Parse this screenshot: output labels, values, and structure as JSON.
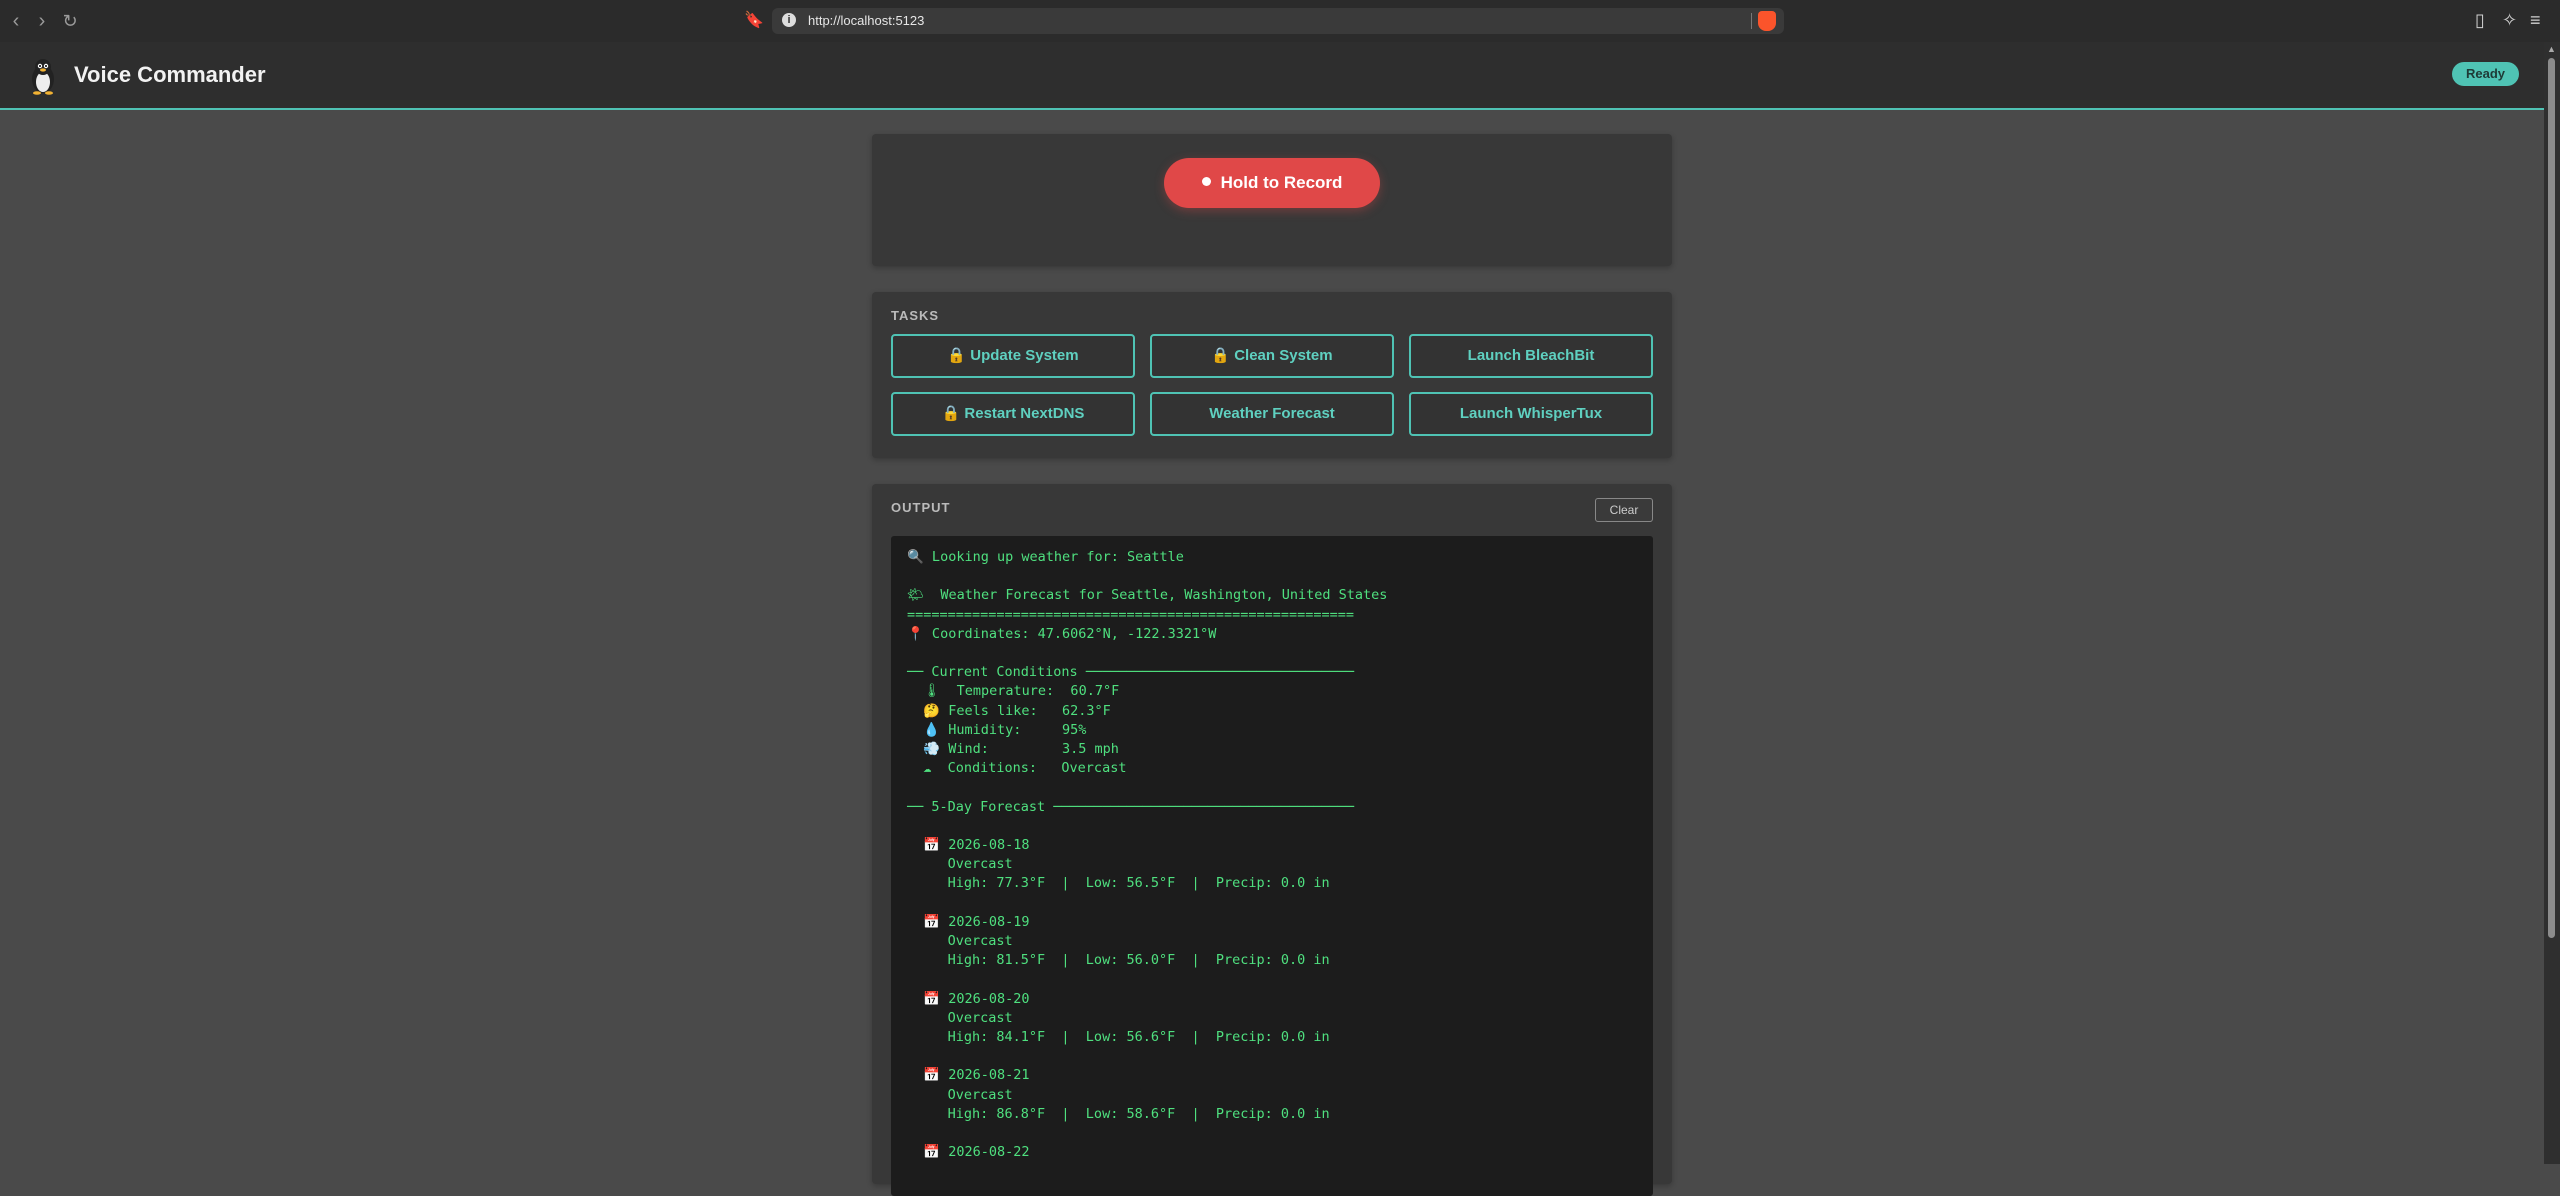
{
  "browser": {
    "url": "http://localhost:5123"
  },
  "app": {
    "title": "Voice Commander",
    "status": "Ready",
    "logo_icon": "penguin-icon"
  },
  "record": {
    "label": "Hold to Record"
  },
  "tasks": {
    "heading": "TASKS",
    "buttons": [
      {
        "label": "🔒 Update System"
      },
      {
        "label": "🔒 Clean System"
      },
      {
        "label": "Launch BleachBit"
      },
      {
        "label": "🔒 Restart NextDNS"
      },
      {
        "label": "Weather Forecast"
      },
      {
        "label": "Launch WhisperTux"
      }
    ]
  },
  "output": {
    "heading": "OUTPUT",
    "clear_label": "Clear",
    "text": "🔍 Looking up weather for: Seattle\n\n🌤  Weather Forecast for Seattle, Washington, United States\n=======================================================\n📍 Coordinates: 47.6062°N, -122.3321°W\n\n── Current Conditions ─────────────────────────────────\n  🌡  Temperature:  60.7°F\n  🤔 Feels like:   62.3°F\n  💧 Humidity:     95%\n  💨 Wind:         3.5 mph\n  ☁  Conditions:   Overcast\n\n── 5-Day Forecast ─────────────────────────────────────\n\n  📅 2026-08-18\n     Overcast\n     High: 77.3°F  |  Low: 56.5°F  |  Precip: 0.0 in\n\n  📅 2026-08-19\n     Overcast\n     High: 81.5°F  |  Low: 56.0°F  |  Precip: 0.0 in\n\n  📅 2026-08-20\n     Overcast\n     High: 84.1°F  |  Low: 56.6°F  |  Precip: 0.0 in\n\n  📅 2026-08-21\n     Overcast\n     High: 86.8°F  |  Low: 58.6°F  |  Precip: 0.0 in\n\n  📅 2026-08-22"
  },
  "colors": {
    "accent": "#4fc3b4",
    "record": "#e04848",
    "terminal_text": "#4fe07f"
  }
}
